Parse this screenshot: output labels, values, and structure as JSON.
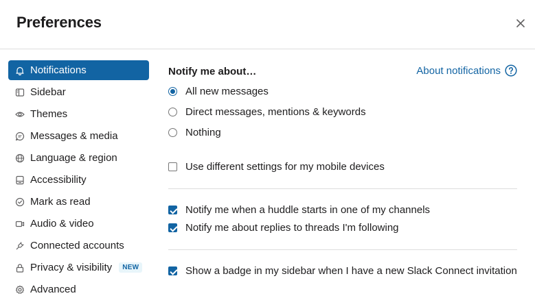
{
  "header": {
    "title": "Preferences",
    "close_icon": "close-icon"
  },
  "sidebar": {
    "items": [
      {
        "label": "Notifications",
        "icon": "bell-icon",
        "active": true
      },
      {
        "label": "Sidebar",
        "icon": "sidebar-icon"
      },
      {
        "label": "Themes",
        "icon": "eye-icon"
      },
      {
        "label": "Messages & media",
        "icon": "message-icon"
      },
      {
        "label": "Language & region",
        "icon": "globe-icon"
      },
      {
        "label": "Accessibility",
        "icon": "accessibility-icon"
      },
      {
        "label": "Mark as read",
        "icon": "check-circle-icon"
      },
      {
        "label": "Audio & video",
        "icon": "video-icon"
      },
      {
        "label": "Connected accounts",
        "icon": "plug-icon"
      },
      {
        "label": "Privacy & visibility",
        "icon": "lock-icon",
        "badge": "NEW"
      },
      {
        "label": "Advanced",
        "icon": "gear-icon"
      }
    ]
  },
  "main": {
    "section_title": "Notify me about…",
    "about_link": "About notifications",
    "notify_options": [
      {
        "label": "All new messages",
        "selected": true
      },
      {
        "label": "Direct messages, mentions & keywords",
        "selected": false
      },
      {
        "label": "Nothing",
        "selected": false
      }
    ],
    "mobile_setting": {
      "label": "Use different settings for my mobile devices",
      "checked": false
    },
    "huddle_setting": {
      "label": "Notify me when a huddle starts in one of my channels",
      "checked": true
    },
    "threads_setting": {
      "label": "Notify me about replies to threads I'm following",
      "checked": true
    },
    "badge_setting": {
      "label": "Show a badge in my sidebar when I have a new Slack Connect invitation",
      "checked": true
    }
  },
  "colors": {
    "accent": "#1264a3",
    "divider": "#dddddd",
    "text": "#1d1c1d"
  }
}
